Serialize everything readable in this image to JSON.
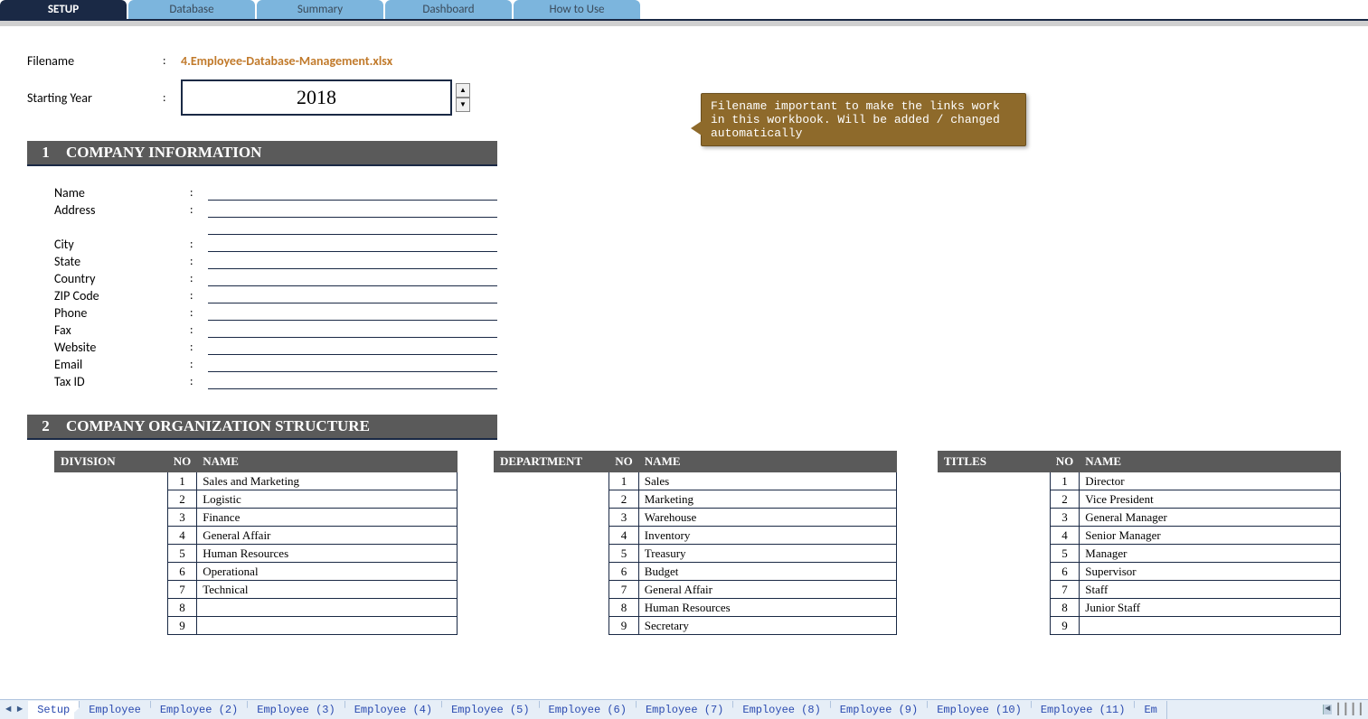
{
  "topTabs": {
    "active": "SETUP",
    "items": [
      "SETUP",
      "Database",
      "Summary",
      "Dashboard",
      "How to Use"
    ]
  },
  "meta": {
    "filenameLabel": "Filename",
    "filenameValue": "4.Employee-Database-Management.xlsx",
    "startingYearLabel": "Starting Year",
    "startingYearValue": "2018",
    "colon": ":"
  },
  "callout": "Filename important to make the links work in this workbook. Will be added / changed automatically",
  "section1": {
    "num": "1",
    "title": "COMPANY INFORMATION",
    "fields": [
      "Name",
      "Address",
      "",
      "City",
      "State",
      "Country",
      "ZIP Code",
      "Phone",
      "Fax",
      "Website",
      "Email",
      "Tax ID"
    ]
  },
  "section2": {
    "num": "2",
    "title": "COMPANY ORGANIZATION STRUCTURE"
  },
  "columns": {
    "no": "NO",
    "name": "NAME"
  },
  "tables": {
    "division": {
      "header": "DIVISION",
      "rows": [
        {
          "no": "1",
          "name": "Sales and Marketing"
        },
        {
          "no": "2",
          "name": "Logistic"
        },
        {
          "no": "3",
          "name": "Finance"
        },
        {
          "no": "4",
          "name": "General Affair"
        },
        {
          "no": "5",
          "name": "Human Resources"
        },
        {
          "no": "6",
          "name": "Operational"
        },
        {
          "no": "7",
          "name": "Technical"
        },
        {
          "no": "8",
          "name": ""
        },
        {
          "no": "9",
          "name": ""
        }
      ]
    },
    "department": {
      "header": "DEPARTMENT",
      "rows": [
        {
          "no": "1",
          "name": "Sales"
        },
        {
          "no": "2",
          "name": "Marketing"
        },
        {
          "no": "3",
          "name": "Warehouse"
        },
        {
          "no": "4",
          "name": "Inventory"
        },
        {
          "no": "5",
          "name": "Treasury"
        },
        {
          "no": "6",
          "name": "Budget"
        },
        {
          "no": "7",
          "name": "General Affair"
        },
        {
          "no": "8",
          "name": "Human Resources"
        },
        {
          "no": "9",
          "name": "Secretary"
        }
      ]
    },
    "titles": {
      "header": "TITLES",
      "rows": [
        {
          "no": "1",
          "name": "Director"
        },
        {
          "no": "2",
          "name": "Vice President"
        },
        {
          "no": "3",
          "name": "General Manager"
        },
        {
          "no": "4",
          "name": "Senior Manager"
        },
        {
          "no": "5",
          "name": "Manager"
        },
        {
          "no": "6",
          "name": "Supervisor"
        },
        {
          "no": "7",
          "name": "Staff"
        },
        {
          "no": "8",
          "name": "Junior Staff"
        },
        {
          "no": "9",
          "name": ""
        }
      ]
    }
  },
  "sheetTabs": [
    "Setup",
    "Employee",
    "Employee (2)",
    "Employee (3)",
    "Employee (4)",
    "Employee (5)",
    "Employee (6)",
    "Employee (7)",
    "Employee (8)",
    "Employee (9)",
    "Employee (10)",
    "Employee (11)",
    "Em"
  ]
}
